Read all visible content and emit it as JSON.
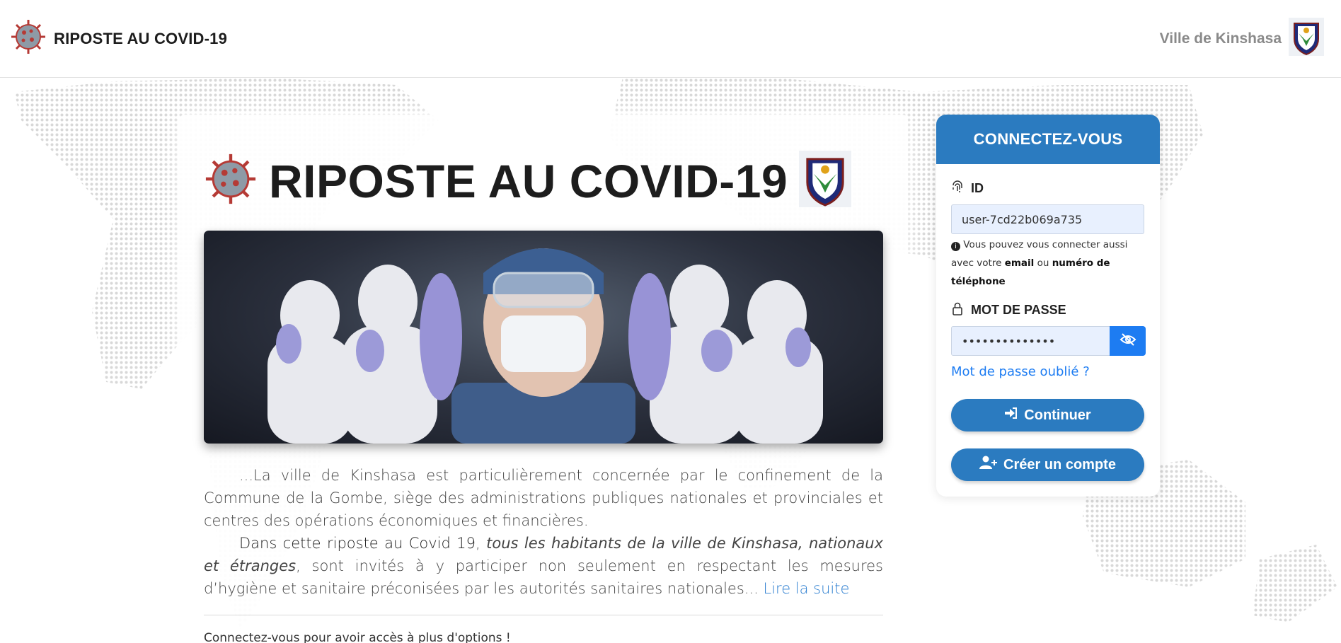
{
  "header": {
    "brand_title": "RIPOSTE AU COVID-19",
    "city_name": "Ville de Kinshasa"
  },
  "main": {
    "title": "RIPOSTE AU COVID-19",
    "intro_p1": "...La ville de Kinshasa est particulièrement concernée par le confinement de la Commune de la Gombe, siège des administrations publiques nationales et provinciales et centres des opérations économiques et financières.",
    "intro_p2_lead": "Dans cette riposte au Covid 19",
    "intro_p2_sep": ", ",
    "intro_p2_italic": "tous les habitants de la ville de Kinshasa, nationaux et étranges",
    "intro_p2_rest": ", sont invités à y participer non seulement en respectant les mesures d’hygiène et sanitaire préconisées par les autorités sanitaires nationales... ",
    "read_more": "Lire la suite",
    "footer_note": "Connectez-vous pour avoir accès à plus d'options !"
  },
  "login": {
    "heading": "CONNECTEZ-VOUS",
    "id_label": "ID",
    "id_value": "user-7cd22b069a735",
    "hint_prefix": "Vous pouvez vous connecter aussi avec votre ",
    "hint_email": "email",
    "hint_or": " ou ",
    "hint_phone": "numéro de téléphone",
    "password_label": "MOT DE PASSE",
    "password_value": "••••••••••••••",
    "forgot": "Mot de passe oublié ?",
    "continue_label": "Continuer",
    "create_label": "Créer un compte"
  },
  "colors": {
    "primary": "#2b7bc0",
    "eye_button": "#1d7cf2",
    "link": "#2a7dd0",
    "input_bg": "#e8f0fe"
  },
  "icons": [
    "virus-icon",
    "kinshasa-crest-icon",
    "fingerprint-icon",
    "lock-icon",
    "eye-slash-icon",
    "info-circle-icon",
    "sign-in-icon",
    "user-plus-icon"
  ]
}
